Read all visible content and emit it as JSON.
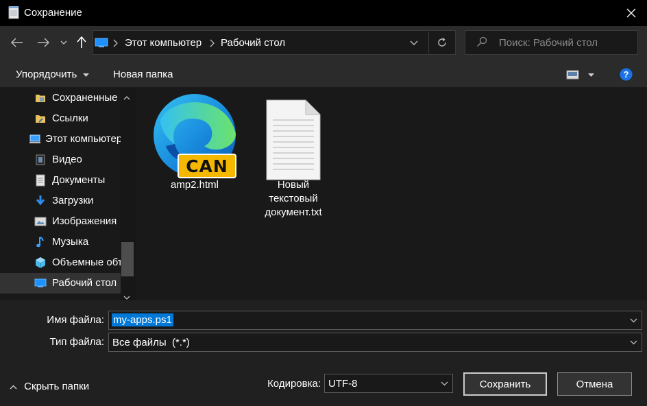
{
  "window": {
    "title": "Сохранение",
    "close_icon": "close-icon"
  },
  "navigation": {
    "back_icon": "arrow-left-icon",
    "forward_icon": "arrow-right-icon",
    "recent_icon": "chevron-down-icon",
    "up_icon": "arrow-up-icon",
    "address": {
      "location_icon": "desktop-icon",
      "segments": [
        "Этот компьютер",
        "Рабочий стол"
      ],
      "dropdown_icon": "chevron-down-icon",
      "refresh_icon": "refresh-icon"
    },
    "search": {
      "placeholder": "Поиск: Рабочий стол",
      "icon": "search-icon"
    }
  },
  "toolbar": {
    "organize_label": "Упорядочить",
    "new_folder_label": "Новая папка",
    "view_icon": "view-icon",
    "help_icon": "help-icon"
  },
  "sidebar": {
    "items": [
      {
        "label": "Сохраненные",
        "icon": "folder-saved-icon"
      },
      {
        "label": "Ссылки",
        "icon": "folder-links-icon"
      },
      {
        "label": "Этот компьютер",
        "icon": "computer-icon"
      },
      {
        "label": "Видео",
        "icon": "video-icon"
      },
      {
        "label": "Документы",
        "icon": "documents-icon"
      },
      {
        "label": "Загрузки",
        "icon": "downloads-icon"
      },
      {
        "label": "Изображения",
        "icon": "pictures-icon"
      },
      {
        "label": "Музыка",
        "icon": "music-icon"
      },
      {
        "label": "Объемные объекты",
        "icon": "3d-objects-icon"
      },
      {
        "label": "Рабочий стол",
        "icon": "desktop-icon",
        "selected": true
      }
    ]
  },
  "files": [
    {
      "name": "amp2.html",
      "icon": "edge-html-icon",
      "badge": "CAN"
    },
    {
      "name_lines": [
        "Новый",
        "текстовый",
        "документ.txt"
      ],
      "icon": "text-file-icon"
    }
  ],
  "form": {
    "filename_label": "Имя файла:",
    "filename_value": "my-apps.ps1",
    "filetype_label": "Тип файла:",
    "filetype_value": "Все файлы  (*.*)",
    "encoding_label": "Кодировка:",
    "encoding_value": "UTF-8",
    "hide_folders_label": "Скрыть папки",
    "save_label": "Сохранить",
    "cancel_label": "Отмена"
  },
  "colors": {
    "accent": "#0078d7",
    "background": "#202020",
    "panel": "#191919",
    "badge": "#f5b800"
  }
}
